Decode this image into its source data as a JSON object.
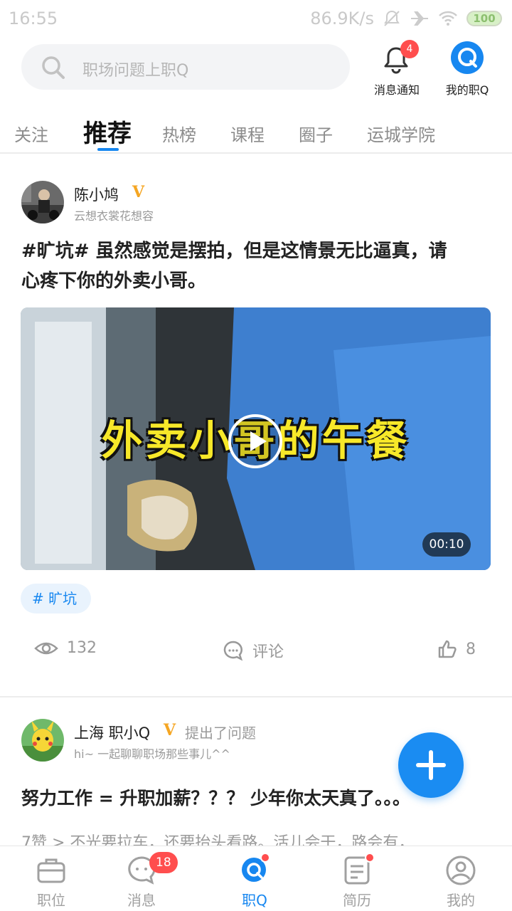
{
  "status_bar": {
    "time": "16:55",
    "net_speed": "86.9K/s",
    "battery": "100"
  },
  "header": {
    "search_placeholder": "职场问题上职Q",
    "notifications_label": "消息通知",
    "notifications_count": "4",
    "my_zhiq_label": "我的职Q"
  },
  "tabs": [
    "关注",
    "推荐",
    "热榜",
    "课程",
    "圈子",
    "运城学院"
  ],
  "active_tab": "推荐",
  "posts": [
    {
      "author": "陈小鸠",
      "verified": "V",
      "subtitle": "云想衣裳花想容",
      "text_line1": "#旷坑# 虽然感觉是摆拍，但是这情景无比逼真，请",
      "text_line2": "心疼下你的外卖小哥。",
      "video_caption": "外卖小哥的午餐",
      "video_duration": "00:10",
      "tag": "旷坑",
      "views": "132",
      "comment_label": "评论",
      "likes": "8"
    },
    {
      "author": "上海 职小Q",
      "verified": "V",
      "action": "提出了问题",
      "subtitle": "hi~ 一起聊聊职场那些事儿^^",
      "title": "努力工作 = 升职加薪？？？ 少年你太天真了。。。",
      "excerpt": "7赞 > 不光要拉车，还要抬头看路。活儿会干，路会有，"
    }
  ],
  "fab_icon": "plus-icon",
  "bottom_nav": [
    {
      "label": "职位",
      "icon": "briefcase-icon"
    },
    {
      "label": "消息",
      "icon": "chat-icon",
      "badge": "18"
    },
    {
      "label": "职Q",
      "icon": "zhiq-icon",
      "active": true
    },
    {
      "label": "简历",
      "icon": "resume-icon"
    },
    {
      "label": "我的",
      "icon": "profile-icon"
    }
  ],
  "colors": {
    "accent": "#1787f0",
    "badge": "#ff4e4e",
    "verified": "#f5a623"
  }
}
